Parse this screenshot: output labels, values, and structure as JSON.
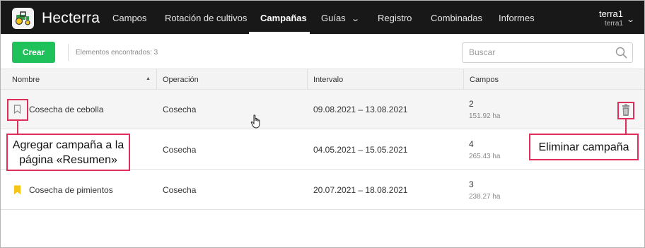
{
  "app": {
    "brand": "Hecterra"
  },
  "nav": {
    "items": [
      {
        "label": "Campos"
      },
      {
        "label": "Rotación de cultivos"
      },
      {
        "label": "Campañas"
      },
      {
        "label": "Guías"
      },
      {
        "label": "Registro"
      },
      {
        "label": "Combinadas"
      },
      {
        "label": "Informes"
      }
    ],
    "active": "Campañas"
  },
  "user": {
    "name": "terra1",
    "account": "terra1"
  },
  "toolbar": {
    "create_label": "Crear",
    "found_text": "Elementos encontrados: 3",
    "search_placeholder": "Buscar"
  },
  "table": {
    "columns": [
      "Nombre",
      "Operación",
      "Intervalo",
      "Campos"
    ],
    "rows": [
      {
        "name": "Cosecha de cebolla",
        "operation": "Cosecha",
        "interval": "09.08.2021 – 13.08.2021",
        "fields": "2",
        "area": "151.92 ha",
        "bookmarked": false
      },
      {
        "name": "",
        "operation": "Cosecha",
        "interval": "04.05.2021 – 15.05.2021",
        "fields": "4",
        "area": "265.43 ha",
        "bookmarked": false
      },
      {
        "name": "Cosecha de pimientos",
        "operation": "Cosecha",
        "interval": "20.07.2021 – 18.08.2021",
        "fields": "3",
        "area": "238.27 ha",
        "bookmarked": true
      }
    ]
  },
  "callouts": {
    "add_to_summary": "Agregar campaña a la página «Resumen»",
    "delete": "Eliminar campaña"
  },
  "colors": {
    "topbar": "#181818",
    "accent_green": "#1fc15b",
    "callout_red": "#e02e5a",
    "bookmark_yellow": "#f5c518"
  },
  "icons": [
    "logo-tractor-icon",
    "chevron-down-icon",
    "search-icon",
    "sort-asc-icon",
    "bookmark-outline-icon",
    "bookmark-filled-icon",
    "trash-icon",
    "hand-cursor-icon"
  ]
}
